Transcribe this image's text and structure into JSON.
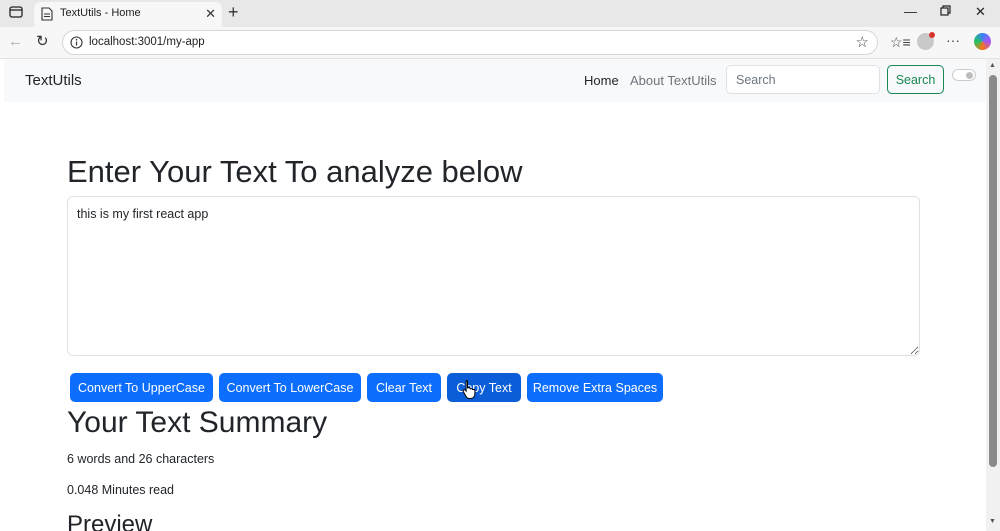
{
  "browser": {
    "tab_title": "TextUtils - Home",
    "url": "localhost:3001/my-app"
  },
  "navbar": {
    "brand": "TextUtils",
    "links": [
      "Home",
      "About TextUtils"
    ],
    "search_placeholder": "Search",
    "search_button": "Search"
  },
  "main": {
    "heading": "Enter Your Text To analyze below",
    "textarea_value": "this is my first react app",
    "buttons": [
      "Convert To UpperCase",
      "Convert To LowerCase",
      "Clear Text",
      "Copy Text",
      "Remove Extra Spaces"
    ],
    "summary_heading": "Your Text Summary",
    "word_count_text": "6 words and 26 characters",
    "read_time_text": "0.048 Minutes read",
    "preview_heading": "Preview"
  },
  "colors": {
    "primary": "#0d6efd",
    "success": "#198754"
  }
}
